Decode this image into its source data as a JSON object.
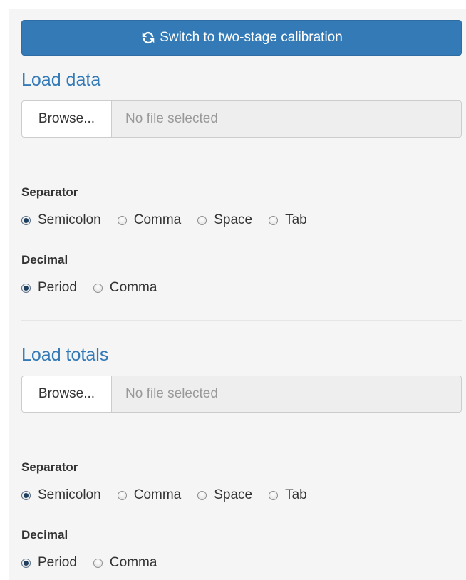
{
  "switch_button": {
    "label": "Switch to two-stage calibration",
    "icon": "refresh-icon"
  },
  "sections": [
    {
      "title": "Load data",
      "browse_label": "Browse...",
      "file_placeholder": "No file selected",
      "separator": {
        "label": "Separator",
        "options": [
          "Semicolon",
          "Comma",
          "Space",
          "Tab"
        ],
        "selected": "Semicolon"
      },
      "decimal": {
        "label": "Decimal",
        "options": [
          "Period",
          "Comma"
        ],
        "selected": "Period"
      }
    },
    {
      "title": "Load totals",
      "browse_label": "Browse...",
      "file_placeholder": "No file selected",
      "separator": {
        "label": "Separator",
        "options": [
          "Semicolon",
          "Comma",
          "Space",
          "Tab"
        ],
        "selected": "Semicolon"
      },
      "decimal": {
        "label": "Decimal",
        "options": [
          "Period",
          "Comma"
        ],
        "selected": "Period"
      }
    }
  ],
  "colors": {
    "primary": "#337ab7",
    "panel_background": "#f5f5f5"
  }
}
